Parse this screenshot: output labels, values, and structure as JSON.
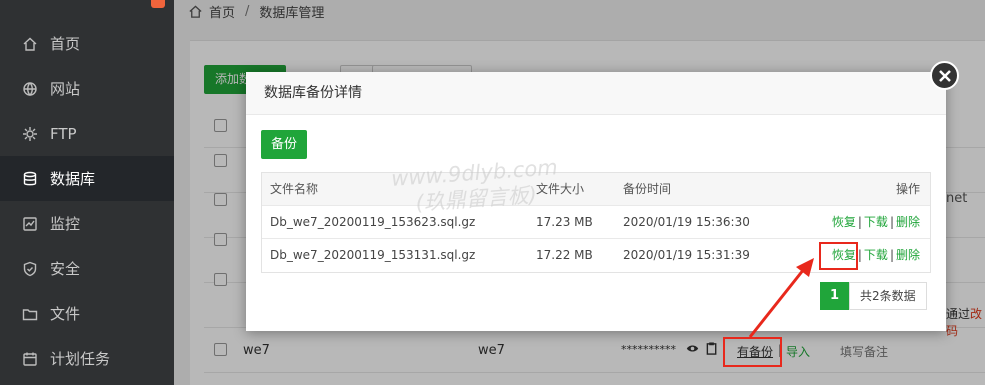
{
  "sidebar": {
    "items": [
      {
        "label": "首页",
        "icon": "home-icon"
      },
      {
        "label": "网站",
        "icon": "globe-icon"
      },
      {
        "label": "FTP",
        "icon": "ftp-icon"
      },
      {
        "label": "数据库",
        "icon": "database-icon",
        "active": true
      },
      {
        "label": "监控",
        "icon": "monitor-icon"
      },
      {
        "label": "安全",
        "icon": "shield-icon"
      },
      {
        "label": "文件",
        "icon": "folder-icon"
      },
      {
        "label": "计划任务",
        "icon": "calendar-icon"
      }
    ]
  },
  "breadcrumb": {
    "home": "首页",
    "separator": "/",
    "current": "数据库管理"
  },
  "toolbar": {
    "add_label": "添加数"
  },
  "bg_table": {
    "right_text_1": "net",
    "right_text_2a": "通过",
    "right_text_2b": "改码",
    "row_we7": {
      "name": "we7",
      "user": "we7",
      "password": "**********",
      "backup_link": "有备份",
      "import_link": "导入",
      "remark": "填写备注"
    }
  },
  "modal": {
    "title": "数据库备份详情",
    "backup_button": "备份",
    "headers": {
      "file_name": "文件名称",
      "file_size": "文件大小",
      "backup_time": "备份时间",
      "actions": "操作"
    },
    "rows": [
      {
        "file_name": "Db_we7_20200119_153623.sql.gz",
        "file_size": "17.23 MB",
        "backup_time": "2020/01/19 15:36:30",
        "restore": "恢复",
        "download": "下载",
        "delete": "删除"
      },
      {
        "file_name": "Db_we7_20200119_153131.sql.gz",
        "file_size": "17.22 MB",
        "backup_time": "2020/01/19 15:31:39",
        "restore": "恢复",
        "download": "下载",
        "delete": "删除"
      }
    ],
    "pager": {
      "current_page": "1",
      "total_text": "共2条数据"
    }
  },
  "watermark": {
    "line1": "www.9dlyb.com",
    "line2": "(玖鼎留言板)"
  },
  "colors": {
    "accent": "#20a53a",
    "sidebar": "#2f3133",
    "highlight": "#e8281c"
  }
}
